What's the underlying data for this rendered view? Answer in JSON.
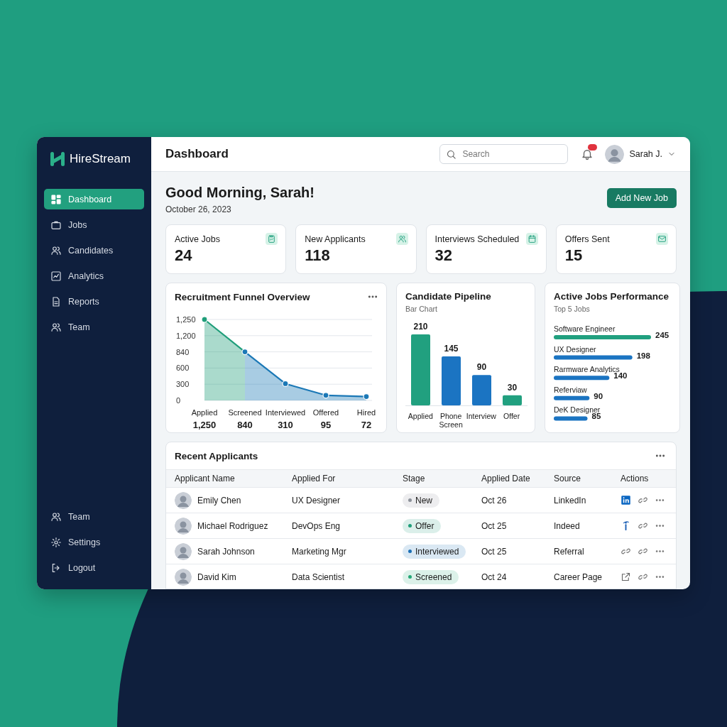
{
  "window": {
    "brand": "HireStream"
  },
  "sidebar": {
    "items": [
      {
        "label": "Dashboard",
        "selected": true
      },
      {
        "label": "Jobs",
        "selected": false
      },
      {
        "label": "Candidates",
        "selected": false
      },
      {
        "label": "Analytics",
        "selected": false
      },
      {
        "label": "Reports",
        "selected": false
      },
      {
        "label": "Team",
        "selected": false
      }
    ],
    "footer_items": [
      {
        "label": "Team"
      },
      {
        "label": "Settings"
      },
      {
        "label": "Logout"
      }
    ]
  },
  "header": {
    "title": "Dashboard",
    "search": {
      "placeholder": "Search"
    },
    "notifications": {
      "unread": true
    },
    "user": {
      "name": "Sarah J."
    }
  },
  "greeting": {
    "title": "Good Morning, Sarah!",
    "date": "October 26, 2023"
  },
  "primary_action": "Add New Job",
  "stats": [
    {
      "label": "Active Jobs",
      "value": "24"
    },
    {
      "label": "New Applicants",
      "value": "118"
    },
    {
      "label": "Interviews Scheduled",
      "value": "32"
    },
    {
      "label": "Offers Sent",
      "value": "15"
    }
  ],
  "funnel": {
    "title": "Recruitment Funnel Overview",
    "axis_labels": [
      "1,250",
      "1,200",
      "840",
      "600",
      "300",
      "0"
    ],
    "stages": [
      {
        "label": "Applied",
        "value": "1,250",
        "color": "#1f9e7a"
      },
      {
        "label": "Screened",
        "value": "840",
        "color": "#1b78b6"
      },
      {
        "label": "Interviewed",
        "value": "310",
        "color": "#1b78b6"
      },
      {
        "label": "Offered",
        "value": "95",
        "color": "#1b78b6"
      },
      {
        "label": "Hired",
        "value": "72",
        "color": "#1b78b6"
      }
    ]
  },
  "pipeline": {
    "title": "Candidate Pipeline",
    "subtitle": "Bar Chart",
    "bars": [
      {
        "label": "Applied",
        "value": "210",
        "color": "#21a07f"
      },
      {
        "label": "Phone Screen",
        "value": "145",
        "color": "#1b74c2"
      },
      {
        "label": "Interview",
        "value": "90",
        "color": "#1b74c2"
      },
      {
        "label": "Offer",
        "value": "30",
        "color": "#21a07f"
      }
    ]
  },
  "jobs_performance": {
    "title": "Active Jobs Performance",
    "subtitle": "Top 5 Jobs",
    "bars": [
      {
        "label": "Software Engineer",
        "value": "245",
        "color": "#21a07f"
      },
      {
        "label": "UX Designer",
        "value": "198",
        "color": "#1b74c2"
      },
      {
        "label": "Rarmware Analytics",
        "value": "140",
        "color": "#1b74c2"
      },
      {
        "label": "Referviaw",
        "value": "90",
        "color": "#1b74c2"
      },
      {
        "label": "DeK Designer",
        "value": "85",
        "color": "#1b74c2"
      }
    ]
  },
  "recent_applicants": {
    "title": "Recent Applicants",
    "columns": [
      "Applicant Name",
      "Applied For",
      "Stage",
      "Applied Date",
      "Source",
      "Actions"
    ],
    "rows": [
      {
        "name": "Emily Chen",
        "applied_for": "UX Designer",
        "stage": {
          "label": "New",
          "color": "#8c9199"
        },
        "date": "Oct 26",
        "source": "LinkedIn"
      },
      {
        "name": "Michael Rodriguez",
        "applied_for": "DevOps Eng",
        "stage": {
          "label": "Offer",
          "color": "#1f9e7a"
        },
        "date": "Oct 25",
        "source": "Indeed"
      },
      {
        "name": "Sarah Johnson",
        "applied_for": "Marketing Mgr",
        "stage": {
          "label": "Interviewed",
          "color": "#1b6fb5"
        },
        "date": "Oct 25",
        "source": "Referral"
      },
      {
        "name": "David Kim",
        "applied_for": "Data Scientist",
        "stage": {
          "label": "Screened",
          "color": "#25a877"
        },
        "date": "Oct 24",
        "source": "Career Page"
      }
    ]
  }
}
